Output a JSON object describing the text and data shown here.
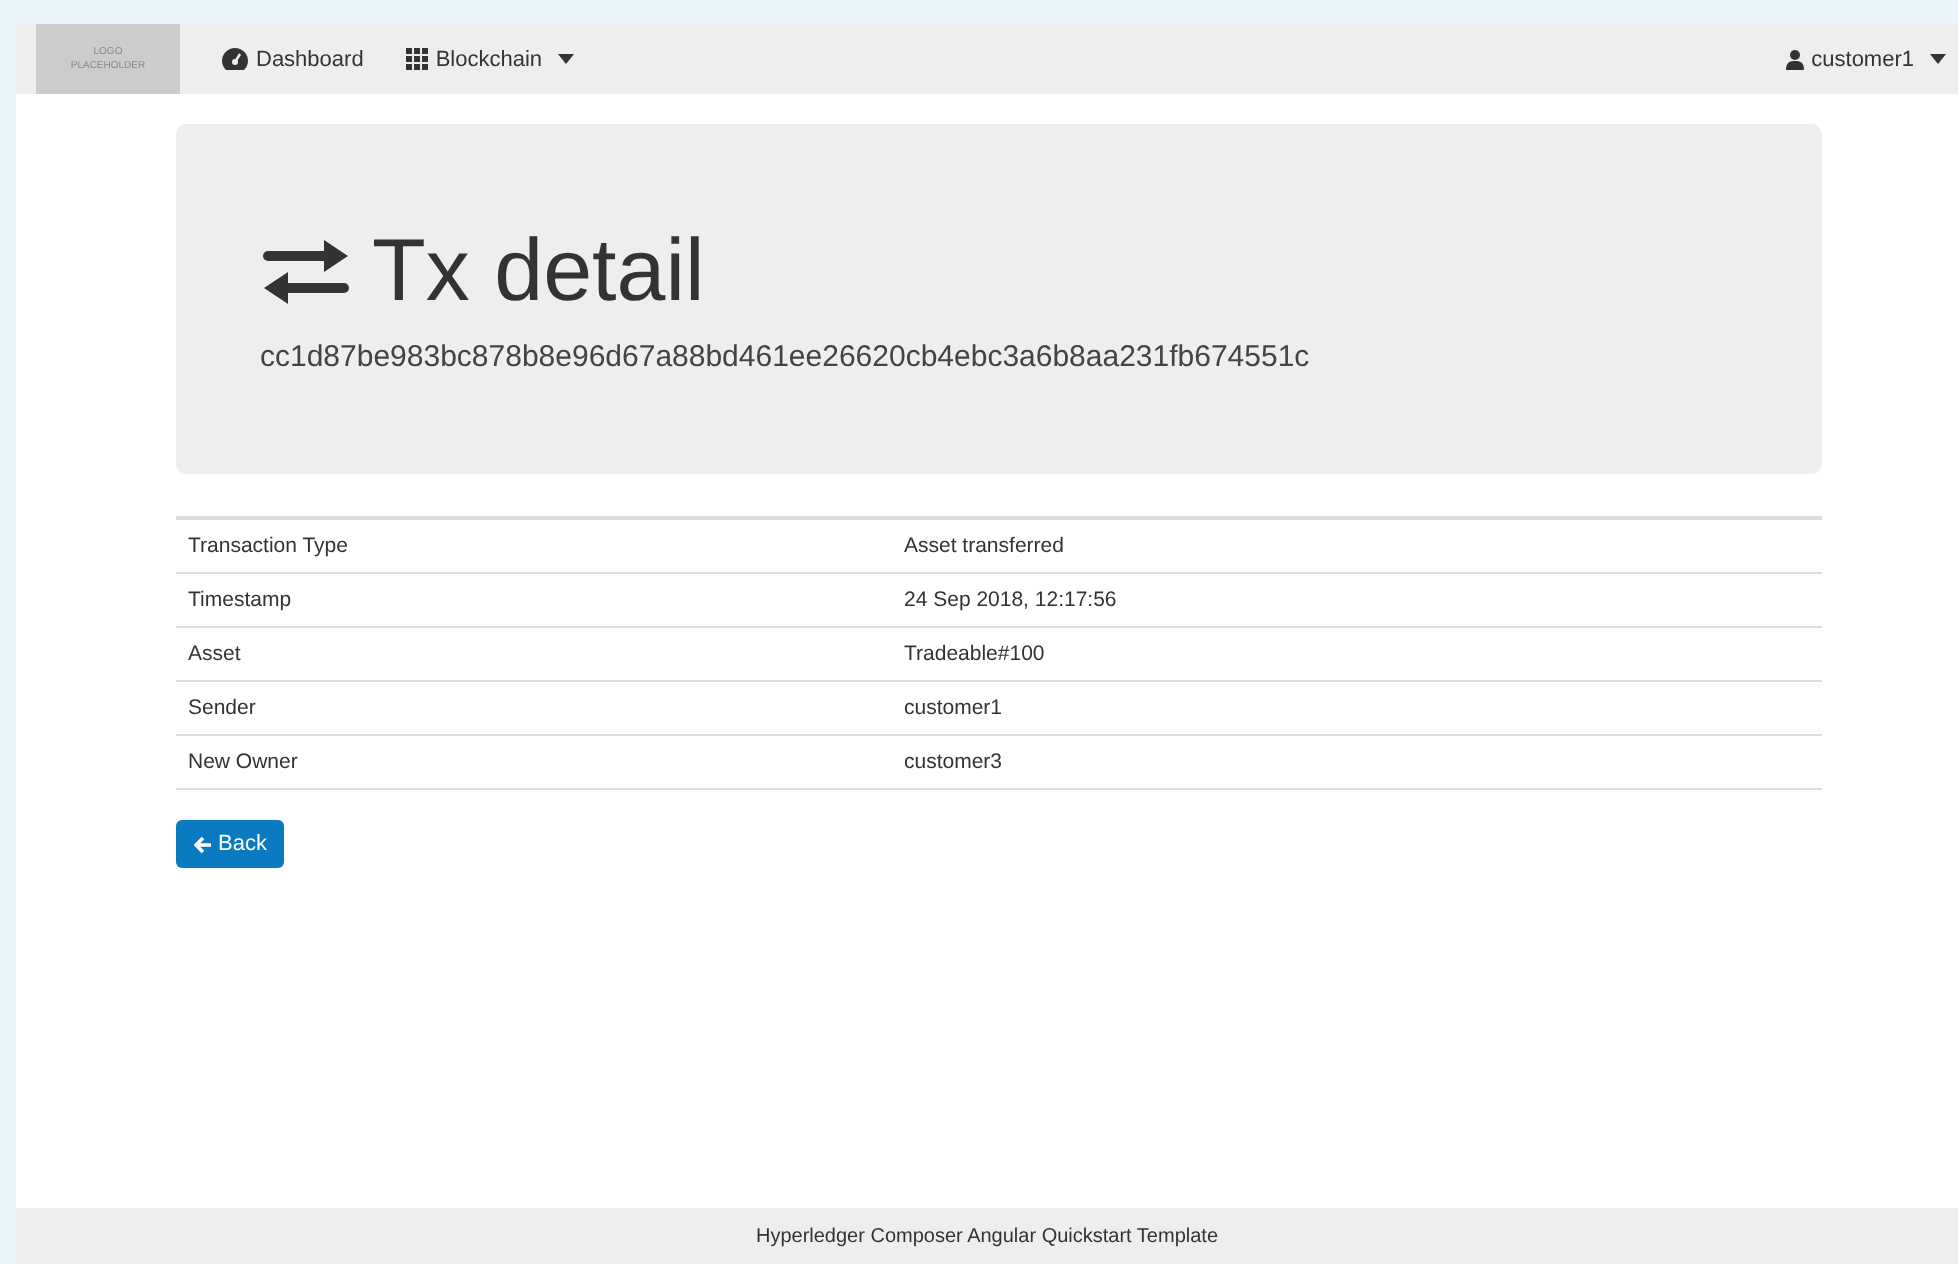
{
  "navbar": {
    "logo": "LOGO PLACEHOLDER",
    "items": [
      {
        "label": "Dashboard",
        "kind": "dashboard",
        "dropdown": false
      },
      {
        "label": "Blockchain",
        "kind": "blockchain",
        "dropdown": true
      }
    ],
    "user": {
      "label": "customer1",
      "dropdown": true
    }
  },
  "header": {
    "title": "Tx detail",
    "hash": "cc1d87be983bc878b8e96d67a88bd461ee26620cb4ebc3a6b8aa231fb674551c"
  },
  "details": [
    {
      "label": "Transaction Type",
      "value": "Asset transferred"
    },
    {
      "label": "Timestamp",
      "value": "24 Sep 2018, 12:17:56"
    },
    {
      "label": "Asset",
      "value": "Tradeable#100"
    },
    {
      "label": "Sender",
      "value": "customer1"
    },
    {
      "label": "New Owner",
      "value": "customer3"
    }
  ],
  "back_button": "Back",
  "footer": "Hyperledger Composer Angular Quickstart Template"
}
